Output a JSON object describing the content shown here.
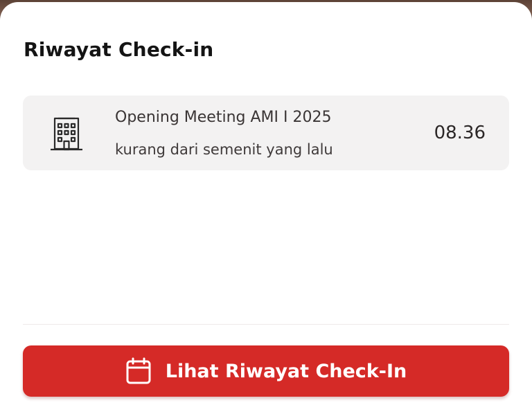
{
  "sheet": {
    "title": "Riwayat Check-in"
  },
  "history": {
    "items": [
      {
        "icon": "building-icon",
        "title": "Opening Meeting AMI I 2025",
        "subtitle": "kurang dari semenit yang lalu",
        "time": "08.36"
      }
    ]
  },
  "action": {
    "icon": "calendar-icon",
    "label": "Lihat Riwayat Check-In"
  },
  "colors": {
    "accent": "#d52a27",
    "card_bg": "#f3f2f2",
    "text_primary": "#141414"
  }
}
